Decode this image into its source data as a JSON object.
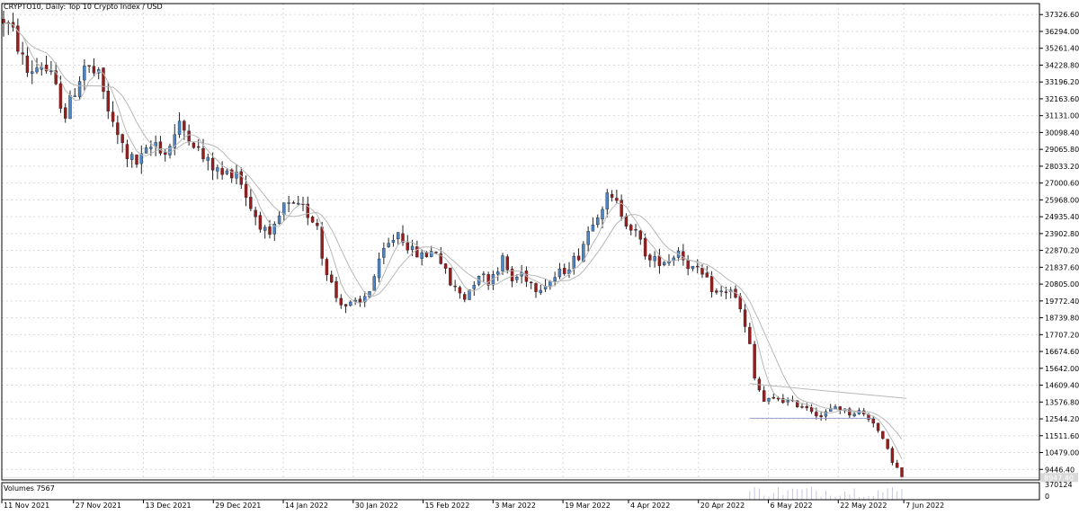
{
  "header": {
    "title": "CRYPTO10, Daily:  Top 10 Crypto Index / USD"
  },
  "volume_panel": {
    "label": "Volumes 7567",
    "scale_labels": [
      "370124",
      "0"
    ]
  },
  "colors": {
    "bull": "#4a86c8",
    "bear": "#9b1c1c",
    "ma": "#b8b8b8",
    "trendline": "#9aa0c8",
    "grid": "#d9d9d9",
    "axis": "#000000"
  },
  "chart_data": {
    "type": "candlestick",
    "title": "CRYPTO10, Daily:  Top 10 Crypto Index / USD",
    "ylim": [
      8800,
      38000
    ],
    "y_ticks": [
      "37326.60",
      "36294.00",
      "35261.40",
      "34228.80",
      "33196.20",
      "32163.60",
      "31131.00",
      "30098.40",
      "29065.80",
      "28033.20",
      "27000.60",
      "25968.00",
      "24935.40",
      "23902.80",
      "22870.20",
      "21837.60",
      "20805.00",
      "19772.40",
      "18739.80",
      "17707.20",
      "16674.60",
      "15642.00",
      "14609.40",
      "13576.80",
      "12544.20",
      "11511.60",
      "10479.00",
      "9446.40"
    ],
    "x_ticks": [
      "11 Nov 2021",
      "27 Nov 2021",
      "13 Dec 2021",
      "29 Dec 2021",
      "14 Jan 2022",
      "30 Jan 2022",
      "15 Feb 2022",
      "3 Mar 2022",
      "19 Mar 2022",
      "4 Apr 2022",
      "20 Apr 2022",
      "6 May 2022",
      "22 May 2022",
      "7 Jun 2022"
    ],
    "price_anchors": [
      [
        0,
        37000
      ],
      [
        2,
        36200
      ],
      [
        5,
        33800
      ],
      [
        8,
        34300
      ],
      [
        10,
        33500
      ],
      [
        13,
        31200
      ],
      [
        17,
        34200
      ],
      [
        20,
        33500
      ],
      [
        23,
        30500
      ],
      [
        26,
        28700
      ],
      [
        28,
        28200
      ],
      [
        32,
        29500
      ],
      [
        34,
        28800
      ],
      [
        37,
        30500
      ],
      [
        39,
        30000
      ],
      [
        42,
        28500
      ],
      [
        46,
        27500
      ],
      [
        49,
        27800
      ],
      [
        52,
        25500
      ],
      [
        56,
        23500
      ],
      [
        59,
        25600
      ],
      [
        63,
        25400
      ],
      [
        66,
        24500
      ],
      [
        67,
        22500
      ],
      [
        70,
        20000
      ],
      [
        72,
        19500
      ],
      [
        75,
        19600
      ],
      [
        77,
        20500
      ],
      [
        80,
        22800
      ],
      [
        83,
        24000
      ],
      [
        86,
        22800
      ],
      [
        88,
        22500
      ],
      [
        91,
        22900
      ],
      [
        94,
        20800
      ],
      [
        97,
        20000
      ],
      [
        100,
        21500
      ],
      [
        102,
        21000
      ],
      [
        105,
        22300
      ],
      [
        107,
        21000
      ],
      [
        109,
        21500
      ],
      [
        112,
        20600
      ],
      [
        115,
        21000
      ],
      [
        118,
        21700
      ],
      [
        121,
        22600
      ],
      [
        124,
        24800
      ],
      [
        127,
        26100
      ],
      [
        129,
        25700
      ],
      [
        131,
        24700
      ],
      [
        133,
        23900
      ],
      [
        136,
        22200
      ],
      [
        140,
        22300
      ],
      [
        142,
        22900
      ],
      [
        144,
        22000
      ],
      [
        147,
        21300
      ],
      [
        150,
        20200
      ],
      [
        153,
        20500
      ],
      [
        155,
        19200
      ],
      [
        157,
        17000
      ],
      [
        158,
        15000
      ],
      [
        160,
        13600
      ],
      [
        163,
        13800
      ],
      [
        166,
        13500
      ],
      [
        169,
        13300
      ],
      [
        172,
        12700
      ],
      [
        175,
        13300
      ],
      [
        178,
        12900
      ],
      [
        180,
        13000
      ],
      [
        183,
        12400
      ],
      [
        185,
        11200
      ],
      [
        187,
        10000
      ],
      [
        189,
        9000
      ]
    ],
    "dates_range": [
      "2021-11-09",
      "2022-06-14"
    ],
    "moving_averages": [
      {
        "period": 5
      },
      {
        "period": 10
      }
    ],
    "annotations": [
      {
        "type": "horizontal_line",
        "price": 12580,
        "from_index": 157,
        "to_index": 183
      },
      {
        "type": "trend_line",
        "from_index": 157,
        "from_price": 14700,
        "to_index": 190,
        "to_price": 13800
      }
    ],
    "current_price_label": "8947.40",
    "volume": {
      "max_label": "370124",
      "min_label": "0",
      "visible_from_index": 157
    }
  }
}
